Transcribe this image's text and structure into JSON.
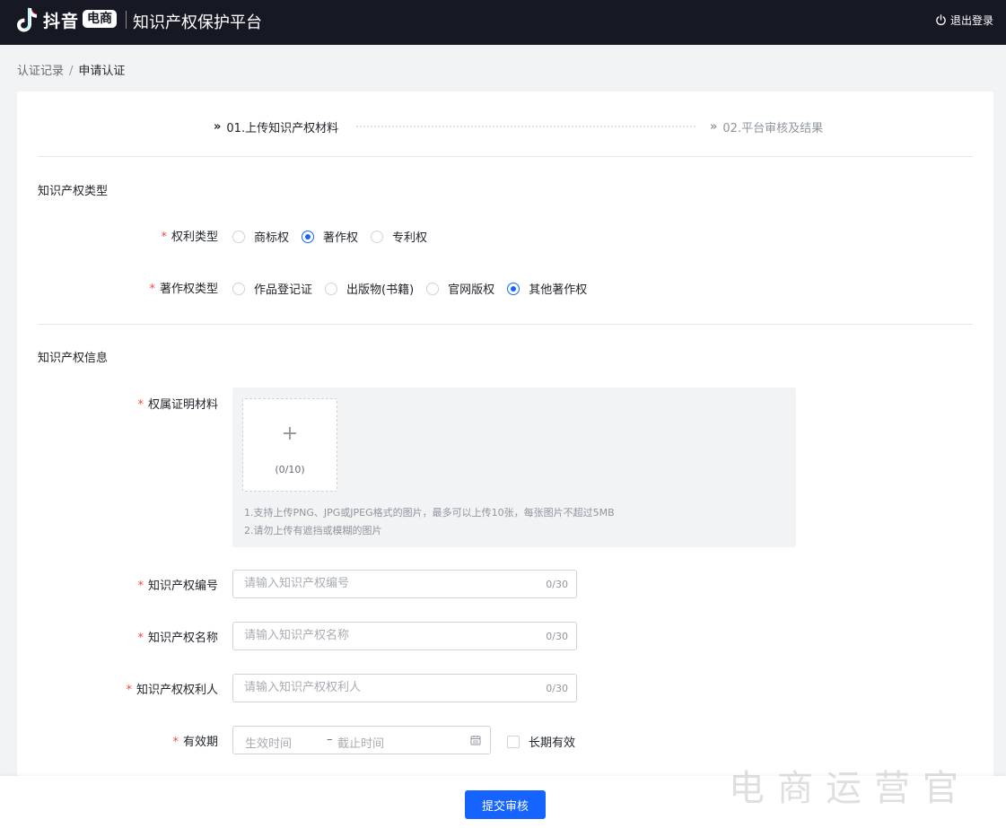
{
  "header": {
    "brand_name": "抖音",
    "brand_badge": "电商",
    "platform_title": "知识产权保护平台",
    "logout_label": "退出登录",
    "logout_icon": "power-icon"
  },
  "breadcrumb": {
    "items": [
      "认证记录",
      "申请认证"
    ],
    "separator": "/"
  },
  "steps": [
    {
      "label": "01.上传知识产权材料",
      "status": "active"
    },
    {
      "label": "02.平台审核及结果",
      "status": "pending"
    }
  ],
  "section_type": {
    "title": "知识产权类型",
    "right_type": {
      "label": "权利类型",
      "required": "*",
      "options": [
        "商标权",
        "著作权",
        "专利权"
      ],
      "selected": "著作权"
    },
    "copyright_type": {
      "label": "著作权类型",
      "required": "*",
      "options": [
        "作品登记证",
        "出版物(书籍)",
        "官网版权",
        "其他著作权"
      ],
      "selected": "其他著作权"
    }
  },
  "section_info": {
    "title": "知识产权信息",
    "proof": {
      "label": "权属证明材料",
      "required": "*",
      "count": "(0/10)",
      "tips": [
        "1.支持上传PNG、JPG或JPEG格式的图片，最多可以上传10张，每张图片不超过5MB",
        "2.请勿上传有遮挡或模糊的图片"
      ]
    },
    "ip_number": {
      "label": "知识产权编号",
      "required": "*",
      "placeholder": "请输入知识产权编号",
      "value": "",
      "counter": "0/30"
    },
    "ip_name": {
      "label": "知识产权名称",
      "required": "*",
      "placeholder": "请输入知识产权名称",
      "value": "",
      "counter": "0/30"
    },
    "ip_holder": {
      "label": "知识产权权利人",
      "required": "*",
      "placeholder": "请输入知识产权权利人",
      "value": "",
      "counter": "0/30"
    },
    "validity": {
      "label": "有效期",
      "required": "*",
      "start_placeholder": "生效时间",
      "separator": "–",
      "end_placeholder": "截止时间",
      "long_term_label": "长期有效",
      "long_term_checked": false
    }
  },
  "footer": {
    "submit_label": "提交审核"
  },
  "watermark": "电商运营官",
  "colors": {
    "header_bg": "#161823",
    "primary": "#1664ff",
    "required": "#f54a45",
    "page_bg": "#f2f3f5"
  }
}
